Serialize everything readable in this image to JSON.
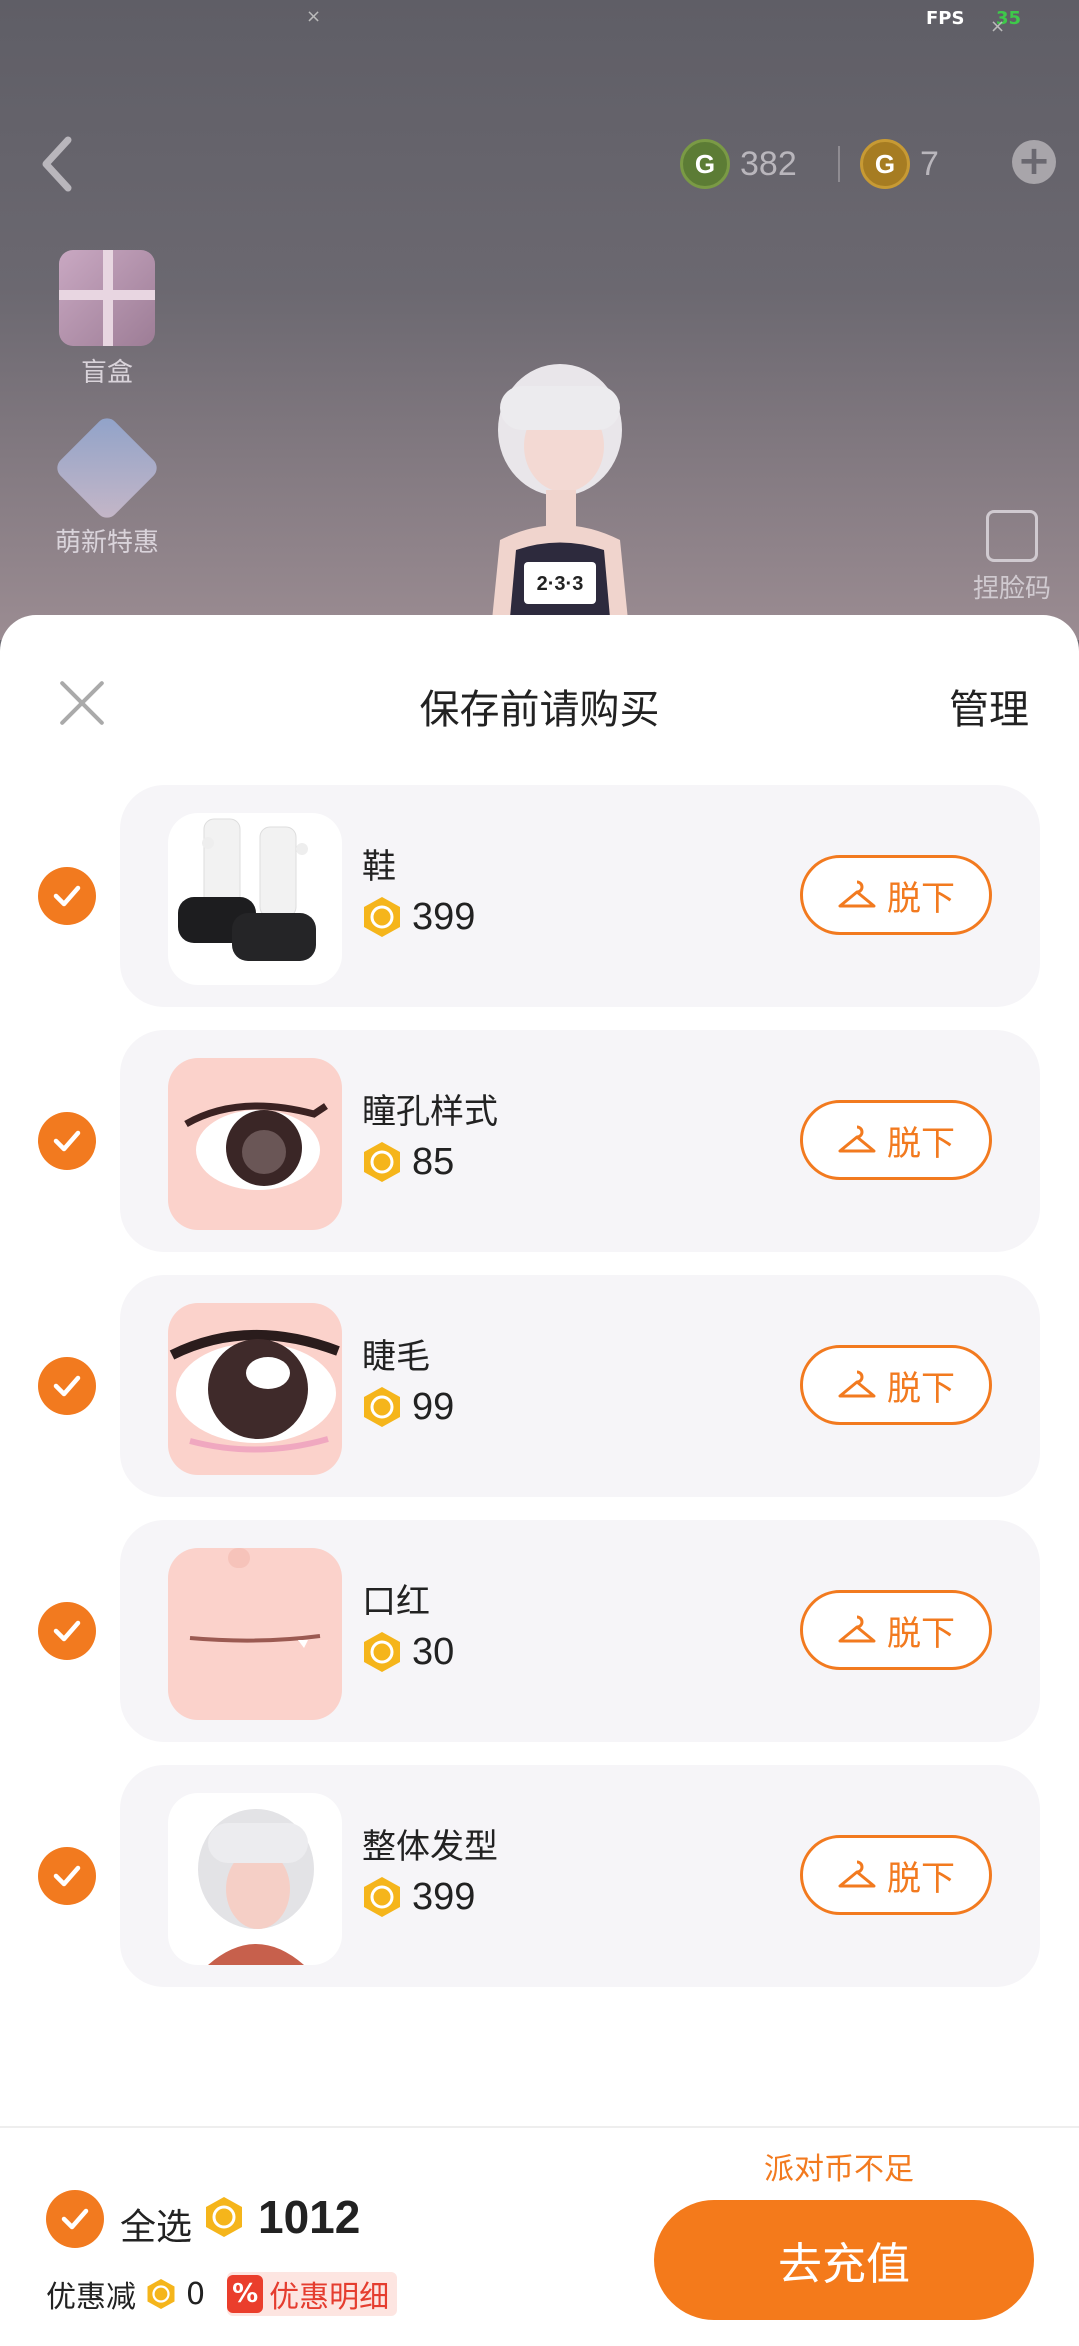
{
  "status": {
    "fps_label": "FPS",
    "fps_value": "35"
  },
  "header": {
    "currency_green": "382",
    "currency_gold": "7"
  },
  "side_menu": [
    {
      "label": "盲盒"
    },
    {
      "label": "萌新特惠"
    }
  ],
  "face_code_label": "捏脸码",
  "character_bib": "2·3·3",
  "sheet": {
    "title": "保存前请购买",
    "manage_label": "管理"
  },
  "items": [
    {
      "name": "鞋",
      "price": "399",
      "action": "脱下"
    },
    {
      "name": "瞳孔样式",
      "price": "85",
      "action": "脱下"
    },
    {
      "name": "睫毛",
      "price": "99",
      "action": "脱下"
    },
    {
      "name": "口红",
      "price": "30",
      "action": "脱下"
    },
    {
      "name": "整体发型",
      "price": "399",
      "action": "脱下"
    }
  ],
  "footer": {
    "insufficient": "派对币不足",
    "select_all": "全选",
    "total": "1012",
    "discount_label": "优惠减",
    "discount_value": "0",
    "discount_tag_icon": "%",
    "discount_detail": "优惠明细",
    "recharge_button": "去充值"
  },
  "colors": {
    "accent": "#f27a1f",
    "card": "#f6f5f8",
    "coin": "#f5b51b"
  }
}
